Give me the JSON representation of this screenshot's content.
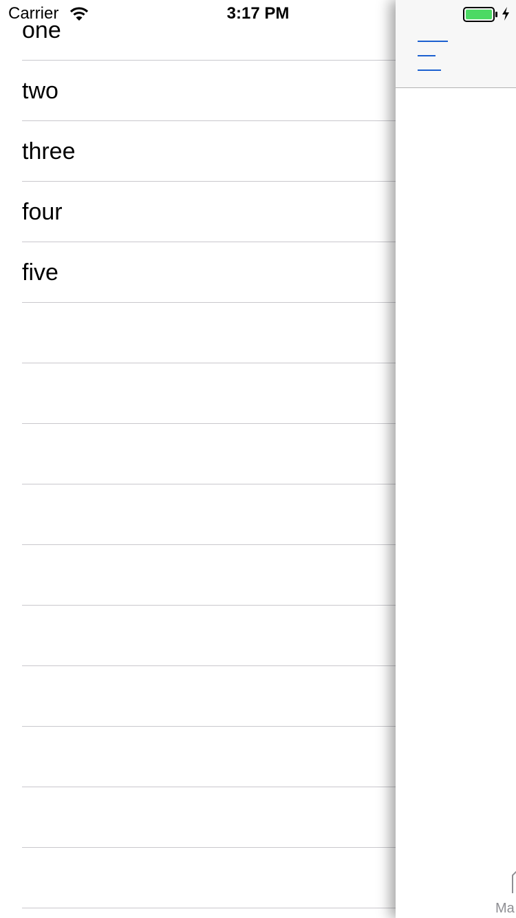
{
  "status_bar": {
    "carrier": "Carrier",
    "time": "3:17 PM",
    "battery_color": "#4cd964"
  },
  "menu": {
    "items": [
      {
        "label": "one"
      },
      {
        "label": "two"
      },
      {
        "label": "three"
      },
      {
        "label": "four"
      },
      {
        "label": "five"
      },
      {
        "label": ""
      },
      {
        "label": ""
      },
      {
        "label": ""
      },
      {
        "label": ""
      },
      {
        "label": ""
      },
      {
        "label": ""
      },
      {
        "label": ""
      },
      {
        "label": ""
      },
      {
        "label": ""
      },
      {
        "label": ""
      }
    ]
  },
  "main": {
    "nav": {
      "menu_icon": "hamburger-menu-icon",
      "accent_color": "#1a5fd0"
    },
    "tab_bar": {
      "first_tab_label": "Ma",
      "first_tab_icon": "home-icon"
    }
  }
}
